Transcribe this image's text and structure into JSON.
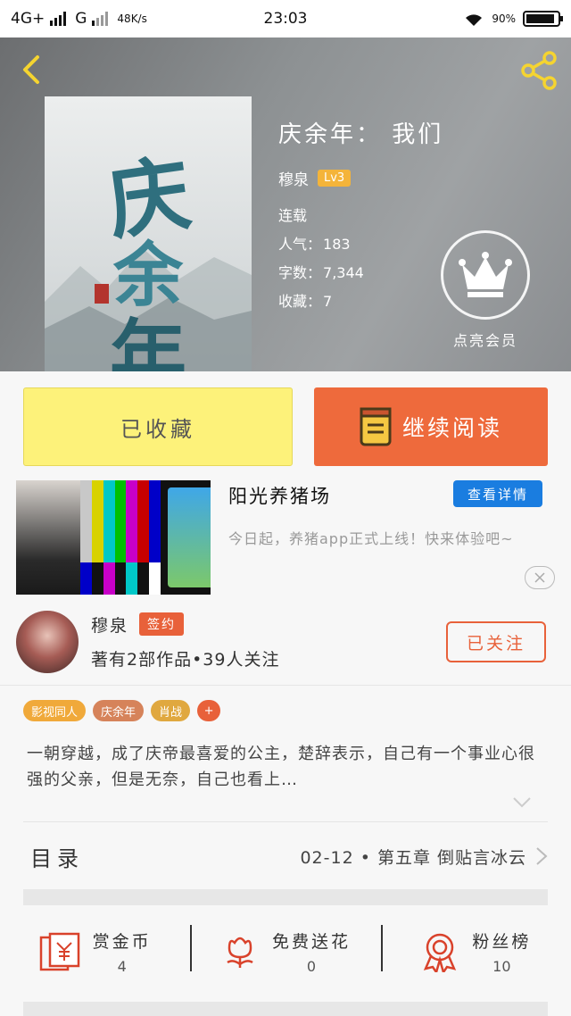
{
  "status_bar": {
    "network1": "4G+",
    "network2": "G",
    "speed": "48K/s",
    "time": "23:03",
    "battery": "90%"
  },
  "book": {
    "cover_text": [
      "庆",
      "余",
      "年"
    ],
    "title": "庆余年：  我们",
    "author": "穆泉",
    "level": "Lv3",
    "status": "连载",
    "popularity_label": "人气：",
    "popularity": "183",
    "words_label": "字数：",
    "words": "7,344",
    "favorites_label": "收藏：",
    "favorites": "7",
    "vip_label": "点亮会员"
  },
  "buttons": {
    "collected": "已收藏",
    "continue_reading": "继续阅读"
  },
  "ad": {
    "title": "阳光养猪场",
    "detail_button": "查看详情",
    "description": "今日起，养猪app正式上线！快来体验吧~"
  },
  "author_info": {
    "name": "穆泉",
    "badge": "签约",
    "stats": "著有2部作品•39人关注",
    "follow_button": "已关注"
  },
  "tags": [
    {
      "label": "影视同人",
      "color": "#f0a93a"
    },
    {
      "label": "庆余年",
      "color": "#d6835a"
    },
    {
      "label": "肖战",
      "color": "#e0a83f"
    }
  ],
  "tag_more": "+",
  "summary": "一朝穿越，成了庆帝最喜爱的公主，楚辞表示，自己有一个事业心很强的父亲，但是无奈，自己也看上…",
  "toc": {
    "label": "目录",
    "latest": "02-12 • 第五章  倒贴言冰云"
  },
  "actions": [
    {
      "label": "赏金币",
      "count": "4",
      "icon": "gold-coin-icon"
    },
    {
      "label": "免费送花",
      "count": "0",
      "icon": "flower-icon"
    },
    {
      "label": "粉丝榜",
      "count": "10",
      "icon": "fan-ranking-icon"
    }
  ],
  "colors": {
    "accent": "#ee6a3c",
    "collected_bg": "#fdf27a",
    "detail_blue": "#1a7de0",
    "icon_red": "#d9422b"
  }
}
